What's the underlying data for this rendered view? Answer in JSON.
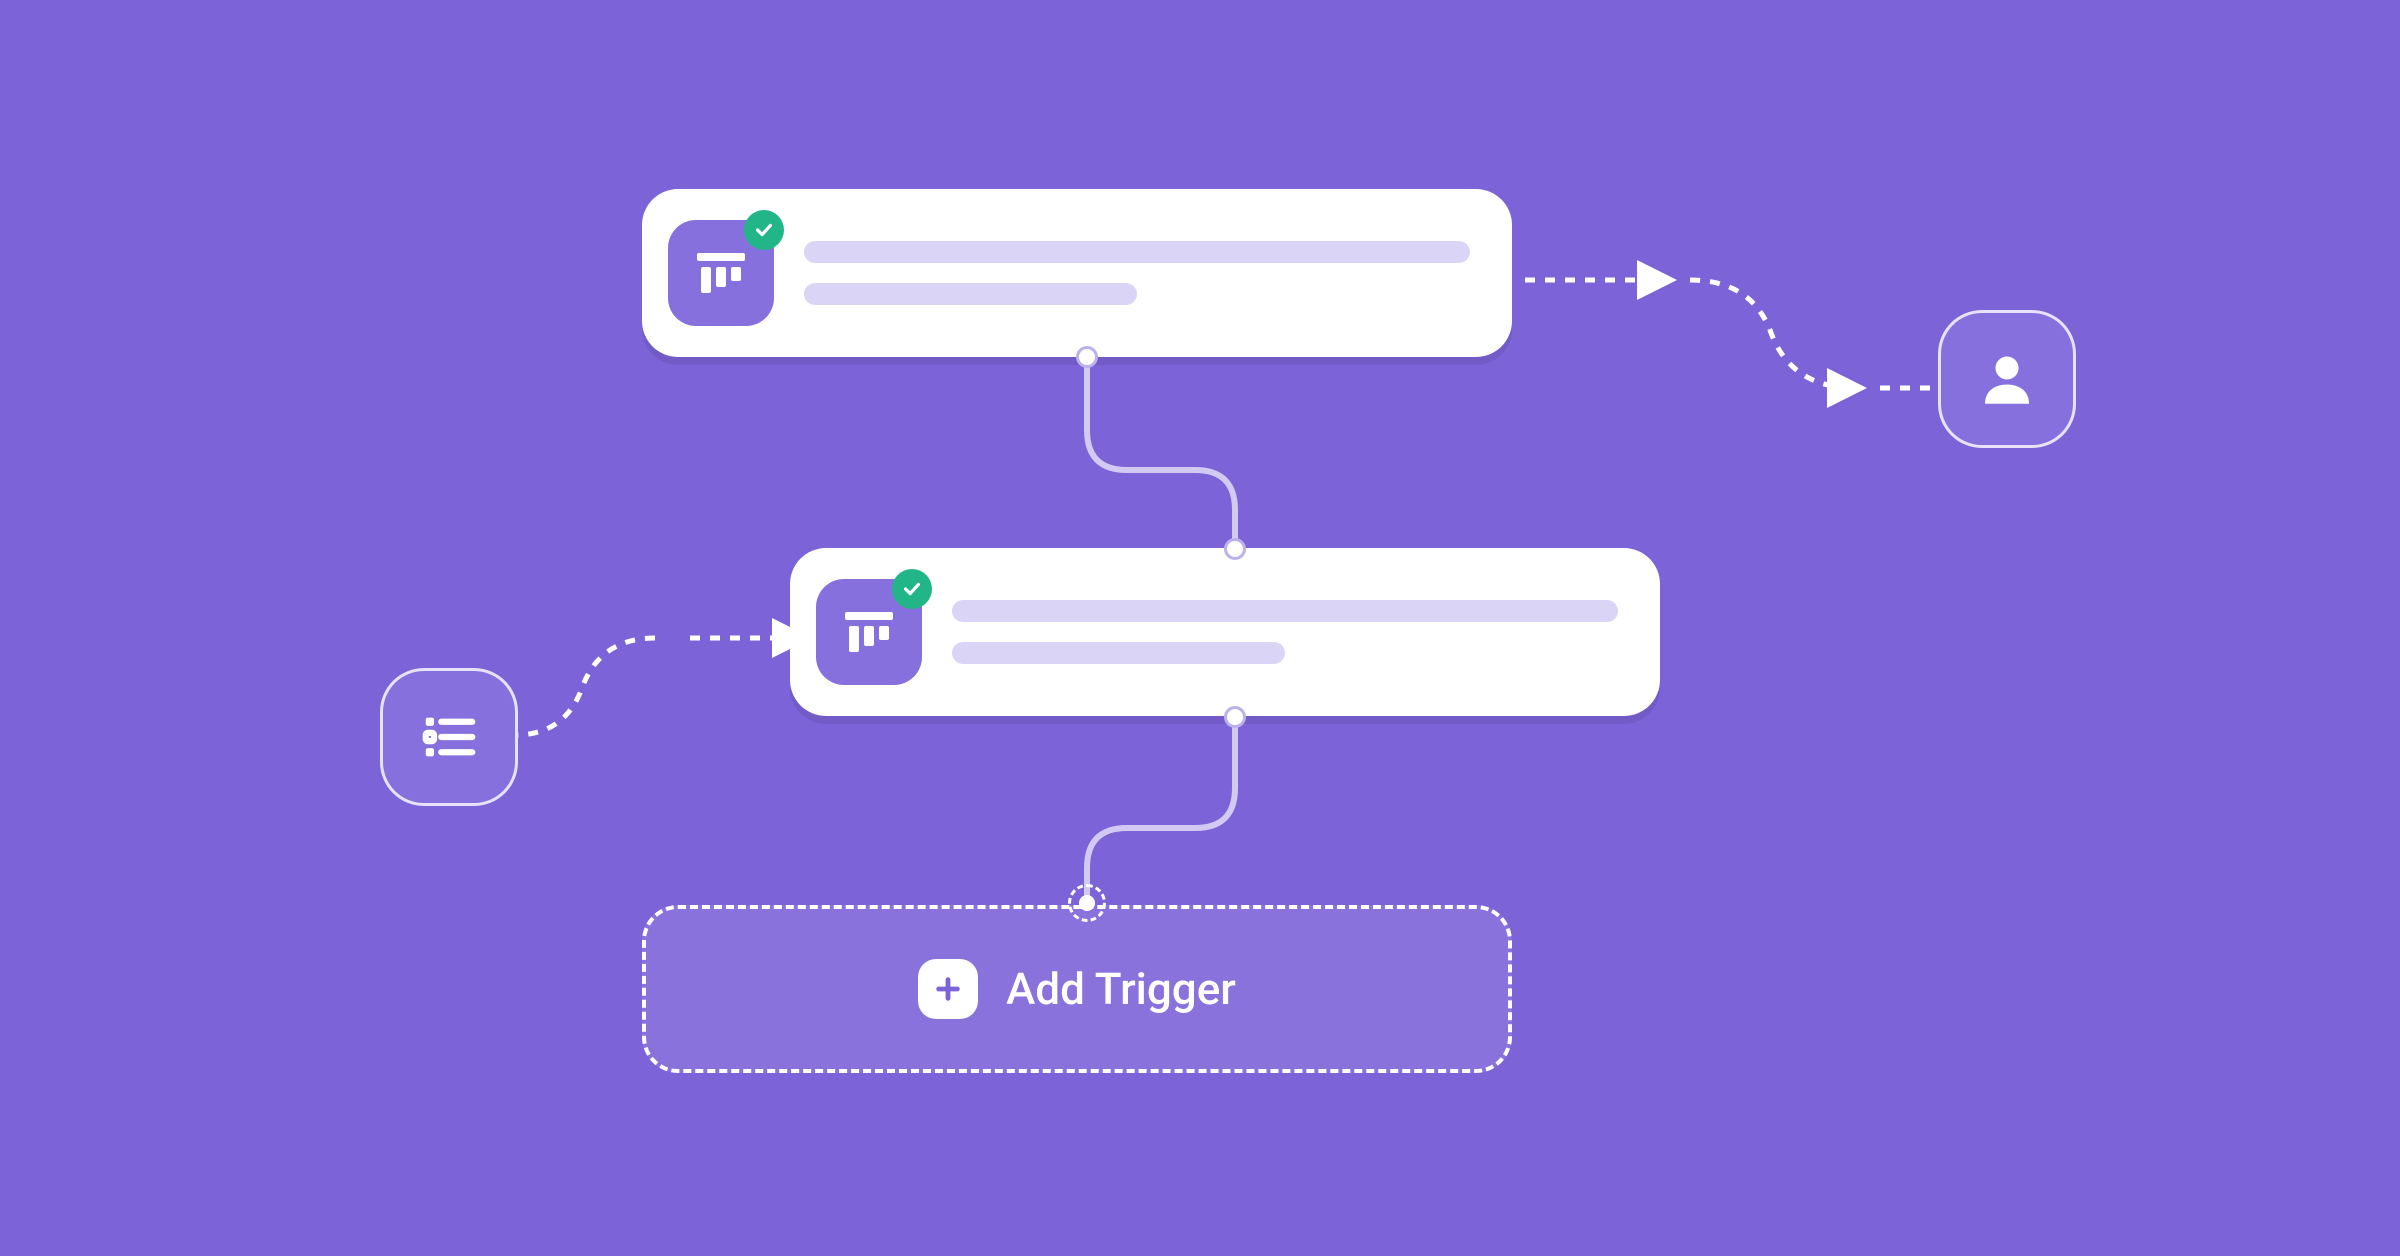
{
  "colors": {
    "bg": "#7C63D8",
    "card": "#FFFFFF",
    "icon_bg": "#8570DE",
    "placeholder": "#DAD4F6",
    "badge": "#22B587",
    "connector": "#D3CAF3"
  },
  "nodes": {
    "step1": {
      "status": "completed"
    },
    "step2": {
      "status": "completed"
    },
    "add_trigger": {
      "label": "Add Trigger"
    }
  },
  "icons": {
    "board": "board-icon",
    "user": "user-icon",
    "list": "list-icon",
    "plus": "plus-icon",
    "check": "check-icon"
  }
}
